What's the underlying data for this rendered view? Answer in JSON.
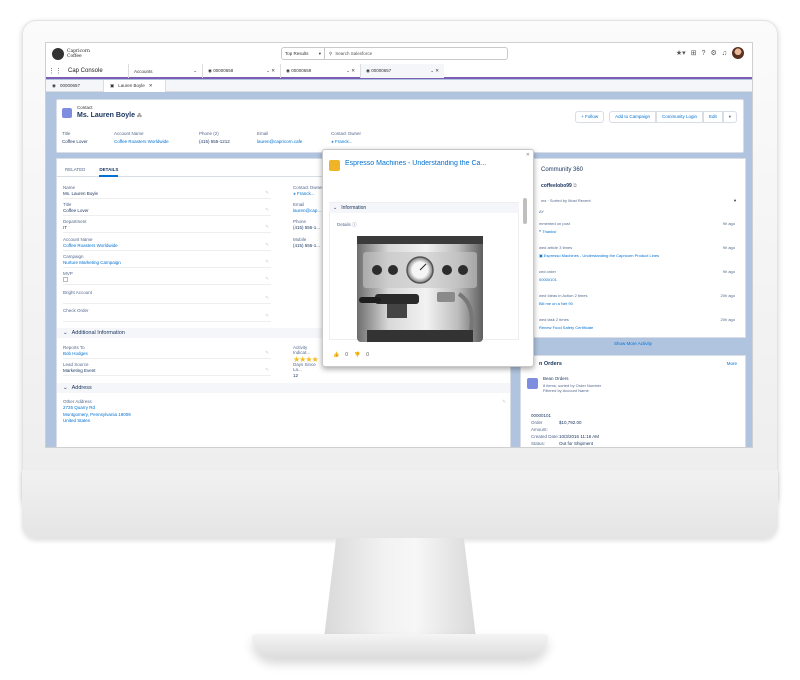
{
  "header": {
    "logo_line1": "Capricorn",
    "logo_line2": "Coffee",
    "search_scope": "Top Results",
    "search_placeholder": "Search Salesforce"
  },
  "nav": {
    "app_name": "Cap Console",
    "tabs": [
      {
        "label": "Accounts"
      },
      {
        "label": "00000658"
      },
      {
        "label": "00000659"
      },
      {
        "label": "00000657"
      }
    ]
  },
  "subtabs": [
    {
      "label": "00000657"
    },
    {
      "label": "Lauren Boyle"
    }
  ],
  "record": {
    "type": "Contact",
    "name": "Ms. Lauren Boyle",
    "buttons": {
      "follow": "+ Follow",
      "add_campaign": "Add to Campaign",
      "community": "Community Login",
      "edit": "Edit"
    },
    "fields": [
      {
        "label": "Title",
        "value": "Coffee Lover",
        "link": false
      },
      {
        "label": "Account Name",
        "value": "Coffee Roasters Worldwide",
        "link": true
      },
      {
        "label": "Phone (2)",
        "value": "(415) 555-1212",
        "link": false
      },
      {
        "label": "Email",
        "value": "lauren@capricorn.cafe",
        "link": true
      },
      {
        "label": "Contact Owner",
        "value": "Franck...",
        "link": true
      }
    ]
  },
  "details": {
    "tabs": {
      "related": "RELATED",
      "details": "DETAILS"
    },
    "left_fields": [
      {
        "label": "Name",
        "value": "Ms. Lauren Boyle"
      },
      {
        "label": "Title",
        "value": "Coffee Lover"
      },
      {
        "label": "Department",
        "value": "IT"
      },
      {
        "label": "Account Name",
        "value": "Coffee Roasters Worldwide"
      },
      {
        "label": "Campaign",
        "value": "Nurture Marketing Campaign"
      },
      {
        "label": "MVP",
        "value": ""
      },
      {
        "label": "Bright Account",
        "value": ""
      },
      {
        "label": "Check Order",
        "value": ""
      }
    ],
    "right_fields": [
      {
        "label": "Contact Owner",
        "value": "Franck..."
      },
      {
        "label": "Email",
        "value": "lauren@cap..."
      },
      {
        "label": "Phone",
        "value": "(415) 555-1..."
      },
      {
        "label": "Mobile",
        "value": "(415) 555-1..."
      }
    ],
    "additional_info_title": "Additional Information",
    "reports_to_label": "Reports To",
    "reports_to_value": "Bob Hodges",
    "lead_source_label": "Lead Source",
    "lead_source_value": "Marketing Event",
    "activity_label": "Activity Indicat...",
    "activity_stars": "★★★★",
    "days_since_label": "Days Since La...",
    "days_since_value": "12",
    "address_title": "Address",
    "other_address_label": "Other Address",
    "address_line1": "2725 Quarry Rd",
    "address_line2": "Montgomery, Pennsylvania 19009",
    "address_line3": "United States"
  },
  "popover": {
    "title": "Espresso Machines - Understanding the Ca...",
    "section": "Information",
    "details_label": "Details",
    "likes": "0",
    "dislikes": "0"
  },
  "community": {
    "title": "Community 360",
    "user": "coffeelobo99",
    "filter": "ms · Sorted by Most Recent",
    "today": "AY",
    "items": [
      {
        "desc": "mmented on post",
        "link": "Thanks!",
        "time": "9h ago"
      },
      {
        "desc": "wed article 3 times",
        "link": "Espresso Machines - Understanding the Capricorn Product Lines",
        "time": "9h ago"
      },
      {
        "desc": "ced order",
        "link": "00000101",
        "time": "9h ago"
      },
      {
        "desc": "wed Ideas in Action 2 times",
        "link": "Bill me on a Net 90",
        "time": "20h ago"
      },
      {
        "desc": "wed task 2 times",
        "link": "Renew Food Safety Certificate",
        "time": "20h ago"
      }
    ],
    "show_more": "Show More Activity"
  },
  "orders": {
    "title": "n Orders",
    "more": "More",
    "subtitle": "Bean Orders",
    "meta1": "8 items, sorted by Order Number",
    "meta2": "Filtered by Account Name",
    "order_number": "00000101",
    "rows": [
      {
        "key": "Order Amount:",
        "value": "$10,792.00"
      },
      {
        "key": "Created Date:",
        "value": "10/3/2016 11:16 AM"
      },
      {
        "key": "Status:",
        "value": "Out for Shipment"
      }
    ]
  }
}
